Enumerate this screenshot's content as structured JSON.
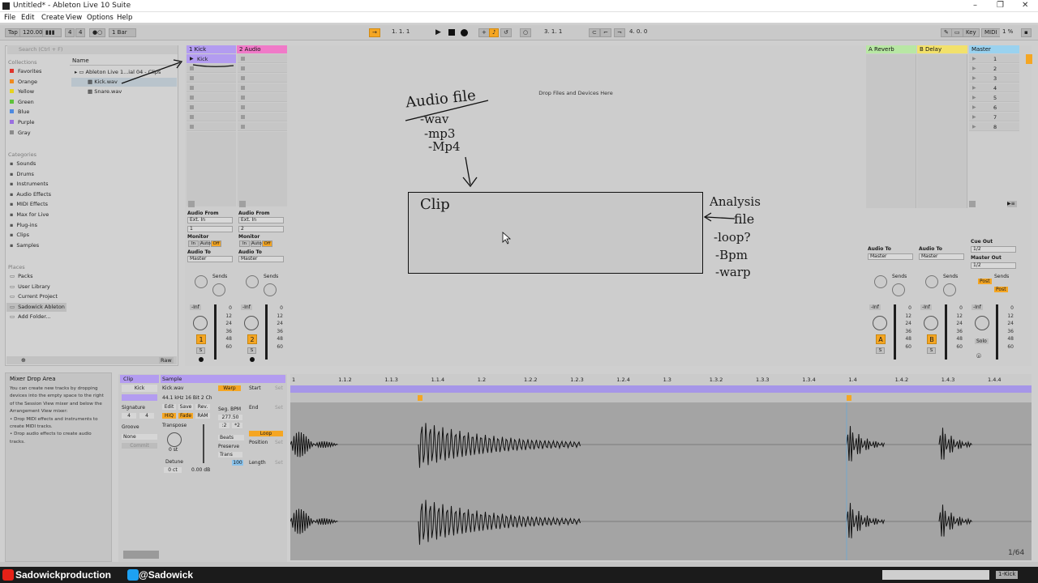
{
  "window": {
    "title": "Untitled* - Ableton Live 10 Suite"
  },
  "menu": [
    "File",
    "Edit",
    "Create",
    "View",
    "Options",
    "Help"
  ],
  "control_bar": {
    "tap": "Tap",
    "tempo": "120.00",
    "sig_num": "4",
    "sig_den": "4",
    "quantize": "1 Bar",
    "position": [
      "1.",
      "1.",
      "1"
    ],
    "loop_start": [
      "3.",
      "1.",
      "1"
    ],
    "loop_length": [
      "4.",
      "0.",
      "0"
    ],
    "key": "Key",
    "midi": "MIDI",
    "cpu": "1 %"
  },
  "browser": {
    "search_placeholder": "Search (Ctrl + F)",
    "collections_title": "Collections",
    "collections": [
      {
        "label": "Favorites",
        "color": "#e0342b"
      },
      {
        "label": "Orange",
        "color": "#f08a1c"
      },
      {
        "label": "Yellow",
        "color": "#e7d21f"
      },
      {
        "label": "Green",
        "color": "#5ec23a"
      },
      {
        "label": "Blue",
        "color": "#4e8ae0"
      },
      {
        "label": "Purple",
        "color": "#9a6fe0"
      },
      {
        "label": "Gray",
        "color": "#8a8a8a"
      }
    ],
    "categories_title": "Categories",
    "categories": [
      "Sounds",
      "Drums",
      "Instruments",
      "Audio Effects",
      "MIDI Effects",
      "Max for Live",
      "Plug-ins",
      "Clips",
      "Samples"
    ],
    "places_title": "Places",
    "places": [
      "Packs",
      "User Library",
      "Current Project",
      "Sadowick Ableton",
      "Add Folder..."
    ],
    "name_header": "Name",
    "files": [
      "Ableton Live 1...ial 04 - Clips",
      "Kick.wav",
      "Snare.wav"
    ],
    "raw": "Raw"
  },
  "tracks": [
    {
      "name": "1 Kick",
      "color": "#b39cf0",
      "clip": "Kick",
      "audio_from": "Audio From",
      "input": "Ext. In",
      "channel": "1",
      "monitor": "Monitor",
      "audio_to": "Audio To",
      "output": "Master",
      "number": "1"
    },
    {
      "name": "2 Audio",
      "color": "#f07ac8",
      "audio_from": "Audio From",
      "input": "Ext. In",
      "channel": "2",
      "monitor": "Monitor",
      "audio_to": "Audio To",
      "output": "Master",
      "number": "2"
    }
  ],
  "monitor_labels": [
    "In",
    "Auto",
    "Off"
  ],
  "sends_label": "Sends",
  "send_letters": [
    "A",
    "B"
  ],
  "volume_label": "-Inf",
  "meter_scale": [
    "0",
    "12",
    "24",
    "36",
    "48",
    "60"
  ],
  "solo_label": "S",
  "returns": [
    {
      "name": "A Reverb",
      "color": "#b8e7a4",
      "number": "A",
      "audio_to": "Audio To",
      "output": "Master"
    },
    {
      "name": "B Delay",
      "color": "#f2e16b",
      "number": "B",
      "audio_to": "Audio To",
      "output": "Master"
    }
  ],
  "master": {
    "name": "Master",
    "color": "#9ad2ef",
    "scenes": [
      "1",
      "2",
      "3",
      "4",
      "5",
      "6",
      "7",
      "8"
    ],
    "cue_out": "Cue Out",
    "cue_val": "1/2",
    "master_out": "Master Out",
    "master_val": "1/2",
    "post": "Post",
    "solo": "Solo"
  },
  "drop_text": "Drop Files and Devices Here",
  "annotations": {
    "audiofile": "Audio file",
    "formats": [
      "-wav",
      "-mp3",
      "-Mp4"
    ],
    "clip": "Clip",
    "analysis": [
      "Analysis",
      "file"
    ],
    "analysis_items": [
      "-loop?",
      "-Bpm",
      "-warp"
    ]
  },
  "info": {
    "title": "Mixer Drop Area",
    "text": "You can create new tracks by dropping devices into the empty space to the right of the Session View mixer and below the Arrangement View mixer:",
    "bullets": [
      "Drop MIDI effects and instruments to create MIDI tracks.",
      "Drop audio effects to create audio tracks."
    ]
  },
  "clip_view": {
    "clip_tab": "Clip",
    "sample_tab": "Sample",
    "clip_name": "Kick",
    "signature": "Signature",
    "sig_num": "4",
    "sig_den": "4",
    "groove": "Groove",
    "groove_val": "None",
    "commit": "Commit",
    "file": "Kick.wav",
    "format": "44.1 kHz 16 Bit 2 Ch",
    "edit": "Edit",
    "save": "Save",
    "rev": "Rev.",
    "hiq": "HiQ",
    "fade": "Fade",
    "ram": "RAM",
    "transpose": "Transpose",
    "transpose_val": "0 st",
    "detune": "Detune",
    "detune_val": "0 ct",
    "gain_val": "0.00 dB",
    "warp": "Warp",
    "seg_bpm": "Seg. BPM",
    "bpm_val": "277.50",
    "half": ":2",
    "double": "*2",
    "mode": "Beats",
    "preserve": "Preserve",
    "trans": "Trans",
    "hundred": "100",
    "start": "Start",
    "end": "End",
    "loop": "Loop",
    "position": "Position",
    "length": "Length",
    "set": "Set"
  },
  "ruler": [
    "1",
    "1.1.2",
    "1.1.3",
    "1.1.4",
    "1.2",
    "1.2.2",
    "1.2.3",
    "1.2.4",
    "1.3",
    "1.3.2",
    "1.3.3",
    "1.3.4",
    "1.4",
    "1.4.2",
    "1.4.3",
    "1.4.4"
  ],
  "zoom": "1/64",
  "footer": {
    "youtube": "Sadowickproduction",
    "twitter": "@Sadowick",
    "track": "1-Kick"
  }
}
